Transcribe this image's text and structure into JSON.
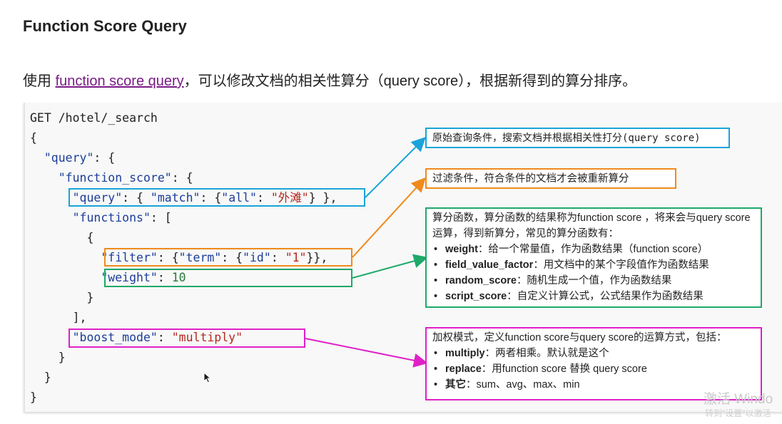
{
  "title": "Function Score Query",
  "intro": {
    "prefix": "使用 ",
    "link": "function score query",
    "suffix": "，可以修改文档的相关性算分（query score），根据新得到的算分排序。"
  },
  "code": {
    "line1": "GET /hotel/_search",
    "open_brace": "{",
    "query_key": "\"query\"",
    "function_score_key": "\"function_score\"",
    "inner_query_key": "\"query\"",
    "match_key": "\"match\"",
    "all_key": "\"all\"",
    "all_value": "\"外滩\"",
    "functions_key": "\"functions\"",
    "filter_key": "\"filter\"",
    "term_key": "\"term\"",
    "id_key": "\"id\"",
    "id_value": "\"1\"",
    "weight_key": "\"weight\"",
    "weight_value": "10",
    "boost_mode_key": "\"boost_mode\"",
    "boost_mode_value": "\"multiply\""
  },
  "notes": {
    "query": "原始查询条件，搜索文档并根据相关性打分(query score)",
    "filter": "过滤条件，符合条件的文档才会被重新算分",
    "functions": {
      "intro": "算分函数，算分函数的结果称为function score ，将来会与query score运算，得到新算分，常见的算分函数有：",
      "items": [
        {
          "name": "weight",
          "desc": "：给一个常量值，作为函数结果（function score）"
        },
        {
          "name": "field_value_factor",
          "desc": "：用文档中的某个字段值作为函数结果"
        },
        {
          "name": "random_score",
          "desc": "：随机生成一个值，作为函数结果"
        },
        {
          "name": "script_score",
          "desc": "：自定义计算公式，公式结果作为函数结果"
        }
      ]
    },
    "boost_mode": {
      "intro": "加权模式，定义function score与query score的运算方式，包括：",
      "items": [
        {
          "name": "multiply",
          "desc": "：两者相乘。默认就是这个"
        },
        {
          "name": "replace",
          "desc": "：用function score 替换 query score"
        },
        {
          "name": "其它",
          "desc": "：sum、avg、max、min"
        }
      ]
    }
  },
  "colors": {
    "query_box": "#1aa3d9",
    "filter_box": "#f08a1c",
    "weight_box": "#1ea86a",
    "boost_box": "#e020c8"
  },
  "watermark": {
    "line1": "激活 Windo",
    "line2": "转到\"设置\"以激活"
  }
}
